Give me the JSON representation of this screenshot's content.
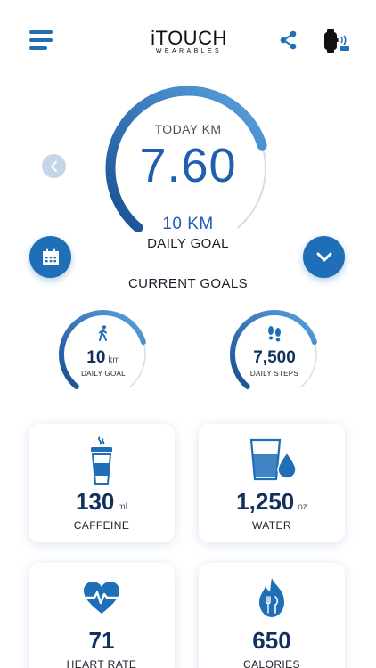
{
  "header": {
    "logo_main": "iTOUCH",
    "logo_sub": "WEARABLES",
    "menu_icon": "hamburger-menu-icon",
    "share_icon": "share-icon",
    "device_icon": "smartwatch-connected-icon"
  },
  "today": {
    "label": "TODAY KM",
    "value": "7.60",
    "goal_value": "10 KM",
    "goal_label": "DAILY GOAL",
    "progress": 0.76
  },
  "nav": {
    "prev_icon": "chevron-left-icon",
    "calendar_icon": "calendar-icon",
    "expand_icon": "chevron-down-icon"
  },
  "current_goals": {
    "title": "CURRENT GOALS",
    "distance": {
      "value": "10",
      "unit": "km",
      "label": "DAILY GOAL",
      "icon": "walking-person-icon",
      "progress": 0.76
    },
    "steps": {
      "value": "7,500",
      "label": "DAILY STEPS",
      "icon": "footprints-icon",
      "progress": 0.76
    }
  },
  "cards": {
    "caffeine": {
      "value": "130",
      "unit": "ml",
      "label": "CAFFEINE",
      "icon": "coffee-cup-icon"
    },
    "water": {
      "value": "1,250",
      "unit": "oz",
      "label": "WATER",
      "icon": "water-glass-icon"
    },
    "heart_rate": {
      "value": "71",
      "label": "HEART RATE",
      "icon": "heart-pulse-icon"
    },
    "calories": {
      "value": "650",
      "label": "CALORIES",
      "icon": "flame-cutlery-icon"
    }
  },
  "colors": {
    "accent": "#1f6fb8",
    "accent_light": "#5aa3e0",
    "track": "#d9dde3",
    "value_dark": "#12305e"
  }
}
